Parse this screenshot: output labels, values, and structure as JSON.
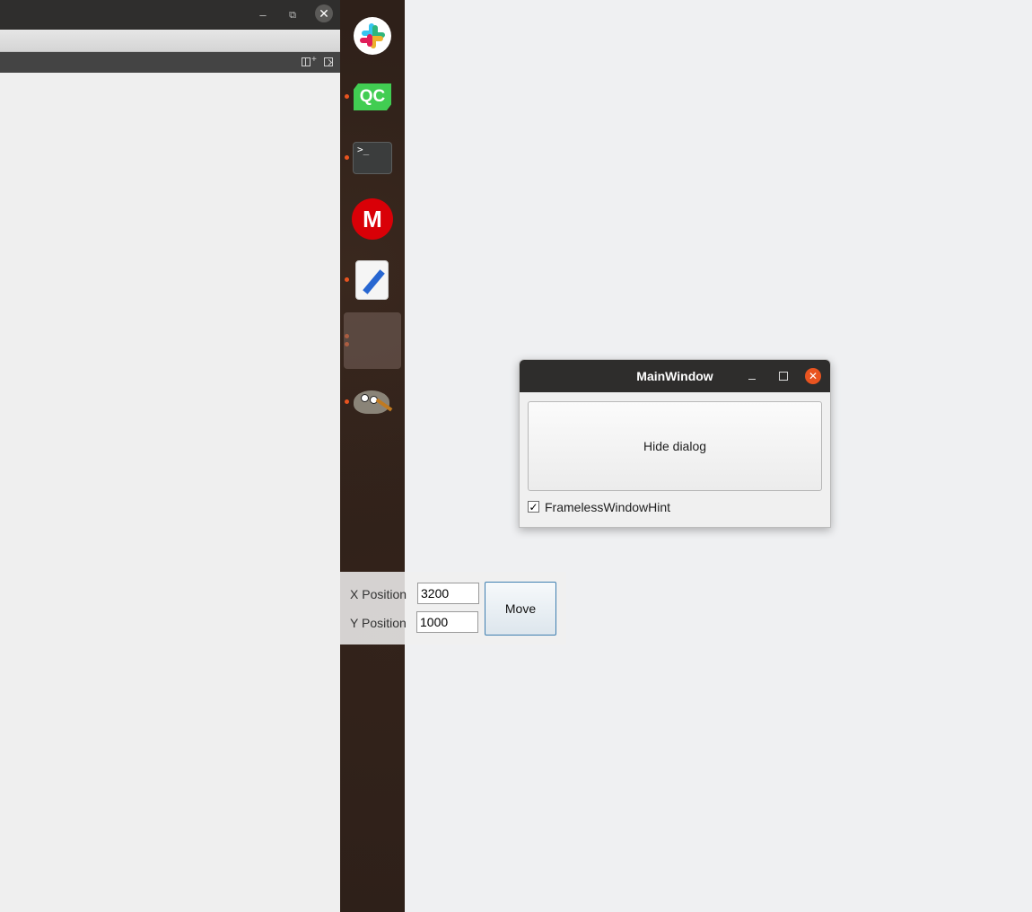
{
  "left_window": {
    "min_glyph": "–",
    "max_glyph": "⧉",
    "close_glyph": "✕",
    "toolbar": {
      "split_plus": "+"
    }
  },
  "dock": {
    "items": [
      {
        "name": "slack",
        "icon": "slack-icon"
      },
      {
        "name": "qt-creator",
        "icon": "qt-creator-icon",
        "label": "QC"
      },
      {
        "name": "terminal",
        "icon": "terminal-icon",
        "label": ">_"
      },
      {
        "name": "mega",
        "icon": "mega-icon",
        "label": "M"
      },
      {
        "name": "text-editor",
        "icon": "text-editor-icon"
      },
      {
        "name": "active-app",
        "icon": "blank-app-icon"
      },
      {
        "name": "gimp",
        "icon": "gimp-icon"
      }
    ],
    "indicator_color": "#e95420"
  },
  "main_window": {
    "title": "MainWindow",
    "close_glyph": "✕",
    "hide_button": "Hide dialog",
    "frameless_checkbox": {
      "label": "FramelessWindowHint",
      "checked": true,
      "check_glyph": "✓"
    }
  },
  "position_panel": {
    "x_label": "X Position",
    "x_value": "3200",
    "y_label": "Y Position",
    "y_value": "1000",
    "move_button": "Move"
  },
  "colors": {
    "accent": "#e95420",
    "qt_green": "#41cd52",
    "mega_red": "#d90007",
    "titlebar": "#2e2d2c"
  }
}
